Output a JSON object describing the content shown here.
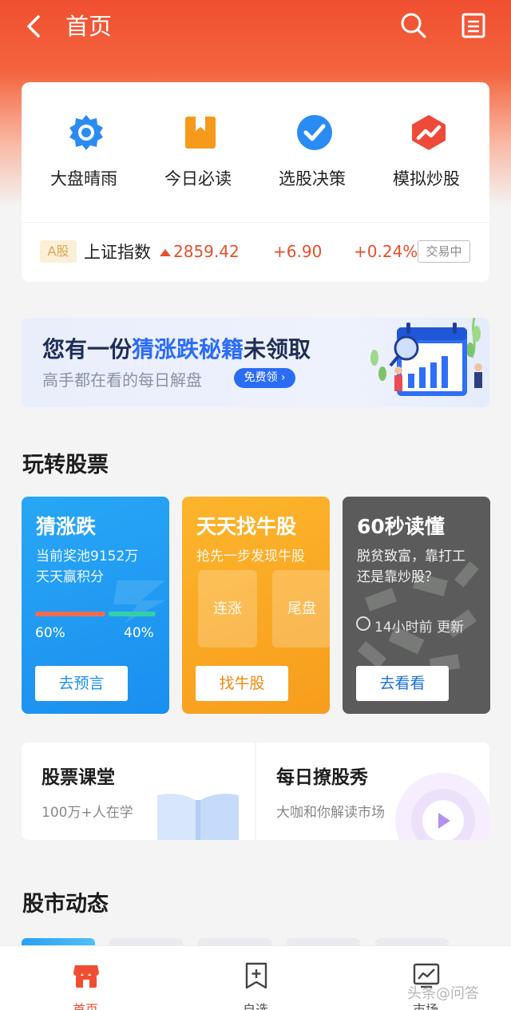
{
  "header": {
    "title": "首页",
    "accent": "#ef4f30"
  },
  "quick_links": [
    {
      "label": "大盘晴雨",
      "icon": "sun-gear-icon",
      "color": "#2a8cf2"
    },
    {
      "label": "今日必读",
      "icon": "bookmark-icon",
      "color": "#f59a1b"
    },
    {
      "label": "选股决策",
      "icon": "check-circle-icon",
      "color": "#2a8cf2"
    },
    {
      "label": "模拟炒股",
      "icon": "chart-trend-icon",
      "color": "#ee4a3a"
    }
  ],
  "ticker": {
    "market_badge": "A股",
    "index_name": "上证指数",
    "price": "2859.42",
    "change": "+6.90",
    "change_pct": "+0.24%",
    "status": "交易中",
    "up_color": "#e6502c"
  },
  "banner": {
    "line1_a": "您有一份",
    "line1_hl": "猜涨跌秘籍",
    "line1_b": "未领取",
    "line2": "高手都在看的每日解盘",
    "button": "免费领"
  },
  "section_play": {
    "title": "玩转股票",
    "cards": [
      {
        "title": "猜涨跌",
        "sub1": "当前奖池9152万",
        "sub2": "天天赢积分",
        "up_pct": "60%",
        "down_pct": "40%",
        "up_share": 0.6,
        "button": "去预言"
      },
      {
        "title": "天天找牛股",
        "sub1": "抢先一步发现牛股",
        "chips": [
          "连涨",
          "尾盘"
        ],
        "button": "找牛股"
      },
      {
        "title": "60秒读懂",
        "sub1": "脱贫致富，靠打工",
        "sub2": "还是靠炒股？",
        "updated": "14小时前 更新",
        "button": "去看看"
      }
    ]
  },
  "wide_cards": [
    {
      "title": "股票课堂",
      "sub": "100万+人在学"
    },
    {
      "title": "每日撩股秀",
      "sub": "大咖和你解读市场"
    }
  ],
  "section_news": {
    "title": "股市动态"
  },
  "tabbar": [
    {
      "label": "首页",
      "icon": "store-icon",
      "active": true
    },
    {
      "label": "自选",
      "icon": "bookmark-plus-icon",
      "active": false
    },
    {
      "label": "市场",
      "icon": "market-chart-icon",
      "active": false
    }
  ],
  "watermark": "头条@问答"
}
